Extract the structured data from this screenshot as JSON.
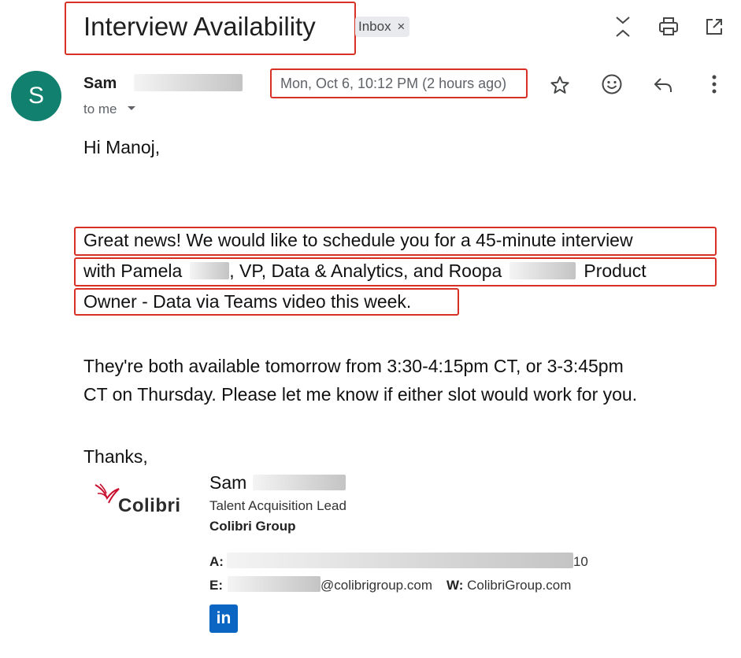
{
  "subject": "Interview Availability",
  "label_chip": {
    "text": "Inbox",
    "remove": "×"
  },
  "toolbar_icons": [
    "collapse-all-icon",
    "print-icon",
    "open-in-new-window-icon"
  ],
  "sender": {
    "avatar_letter": "S",
    "first_name": "Sam",
    "recipient": "to me",
    "avatar_color": "#12806f"
  },
  "message_date": "Mon, Oct 6, 10:12 PM (2 hours ago)",
  "message_actions": [
    "star-icon",
    "emoji-reaction-icon",
    "reply-icon",
    "more-options-icon"
  ],
  "body": {
    "greeting": "Hi Manoj,",
    "para1": {
      "l1": "Great news! We would like to schedule you for a 45-minute interview",
      "l2a": "with Pamela",
      "l2b": ", VP, Data & Analytics, and Roopa",
      "l2c": "Product",
      "l3": "Owner - Data via Teams video this week."
    },
    "para2": {
      "l1": "They're both available tomorrow from 3:30-4:15pm CT, or 3-3:45pm",
      "l2": "CT on Thursday. Please let me know if either slot would work for you."
    },
    "closing": "Thanks,"
  },
  "signature": {
    "logo_text": "Colibri",
    "name": "Sam",
    "title": "Talent Acquisition Lead",
    "company": "Colibri Group",
    "address_label": "A:",
    "address_tail": "10",
    "email_label": "E:",
    "email_domain": "@colibrigroup.com",
    "web_label": "W:",
    "web": "ColibriGroup.com",
    "linkedin": "in"
  },
  "colors": {
    "highlight": "#d93025",
    "linkedin": "#0a66c2",
    "logo": "#c8102e"
  }
}
